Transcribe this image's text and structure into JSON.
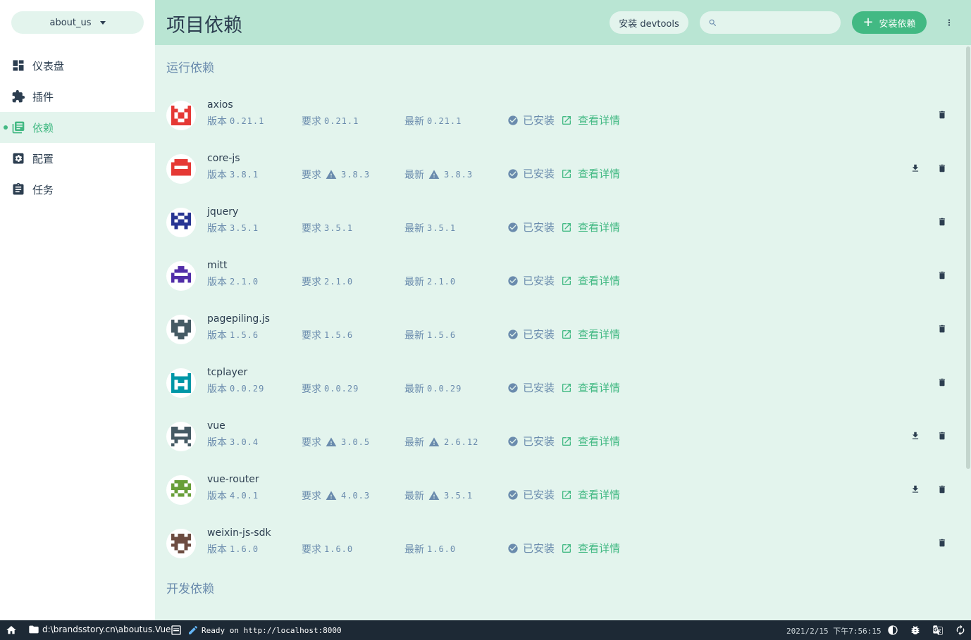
{
  "project": {
    "name": "about_us"
  },
  "nav": [
    {
      "label": "仪表盘",
      "icon": "dashboard-icon",
      "active": false
    },
    {
      "label": "插件",
      "icon": "puzzle-icon",
      "active": false
    },
    {
      "label": "依赖",
      "icon": "library-icon",
      "active": true
    },
    {
      "label": "配置",
      "icon": "settings-icon",
      "active": false
    },
    {
      "label": "任务",
      "icon": "clipboard-icon",
      "active": false
    }
  ],
  "header": {
    "title": "项目依赖",
    "devtools_label": "安装 devtools",
    "search_placeholder": "",
    "install_label": "安装依赖"
  },
  "sections": {
    "runtime": "运行依赖",
    "dev": "开发依赖"
  },
  "labels": {
    "version": "版本",
    "wanted": "要求",
    "latest": "最新",
    "installed": "已安装",
    "details": "查看详情"
  },
  "dependencies": [
    {
      "name": "axios",
      "version": "0.21.1",
      "wanted": "0.21.1",
      "latest": "0.21.1",
      "wanted_warn": false,
      "latest_warn": false,
      "updatable": false,
      "color": "#e53935"
    },
    {
      "name": "core-js",
      "version": "3.8.1",
      "wanted": "3.8.3",
      "latest": "3.8.3",
      "wanted_warn": true,
      "latest_warn": true,
      "updatable": true,
      "color": "#e53935"
    },
    {
      "name": "jquery",
      "version": "3.5.1",
      "wanted": "3.5.1",
      "latest": "3.5.1",
      "wanted_warn": false,
      "latest_warn": false,
      "updatable": false,
      "color": "#283593"
    },
    {
      "name": "mitt",
      "version": "2.1.0",
      "wanted": "2.1.0",
      "latest": "2.1.0",
      "wanted_warn": false,
      "latest_warn": false,
      "updatable": false,
      "color": "#512da8"
    },
    {
      "name": "pagepiling.js",
      "version": "1.5.6",
      "wanted": "1.5.6",
      "latest": "1.5.6",
      "wanted_warn": false,
      "latest_warn": false,
      "updatable": false,
      "color": "#455a64"
    },
    {
      "name": "tcplayer",
      "version": "0.0.29",
      "wanted": "0.0.29",
      "latest": "0.0.29",
      "wanted_warn": false,
      "latest_warn": false,
      "updatable": false,
      "color": "#0097a7"
    },
    {
      "name": "vue",
      "version": "3.0.4",
      "wanted": "3.0.5",
      "latest": "2.6.12",
      "wanted_warn": true,
      "latest_warn": true,
      "updatable": true,
      "color": "#455a64"
    },
    {
      "name": "vue-router",
      "version": "4.0.1",
      "wanted": "4.0.3",
      "latest": "3.5.1",
      "wanted_warn": true,
      "latest_warn": true,
      "updatable": true,
      "color": "#689f38"
    },
    {
      "name": "weixin-js-sdk",
      "version": "1.6.0",
      "wanted": "1.6.0",
      "latest": "1.6.0",
      "wanted_warn": false,
      "latest_warn": false,
      "updatable": false,
      "color": "#6d4c41"
    }
  ],
  "statusbar": {
    "path": "d:\\brandsstory.cn\\aboutus.Vue",
    "log": "Ready on http://localhost:8000",
    "time": "2021/2/15 下午7:56:15"
  },
  "colors": {
    "accent": "#42b983",
    "header_bg": "#b9e5d3",
    "content_bg": "#e3f4ed",
    "muted": "#6a8bad",
    "statusbar_bg": "#1d2935"
  }
}
